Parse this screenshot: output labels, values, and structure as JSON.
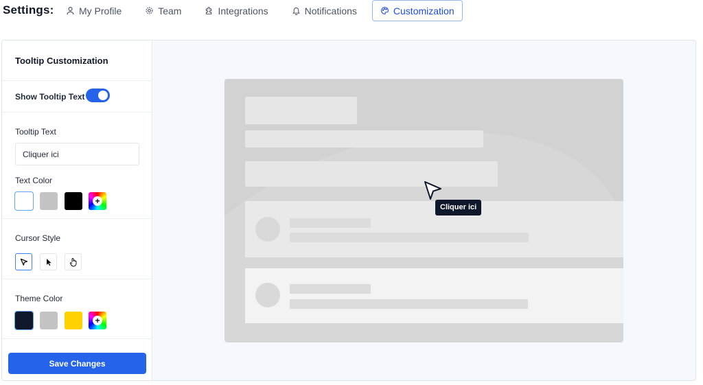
{
  "header": {
    "title": "Settings:",
    "tabs": [
      {
        "label": "My Profile",
        "icon": "user-icon"
      },
      {
        "label": "Team",
        "icon": "gear-icon"
      },
      {
        "label": "Integrations",
        "icon": "puzzle-icon"
      },
      {
        "label": "Notifications",
        "icon": "bell-icon"
      },
      {
        "label": "Customization",
        "icon": "palette-icon",
        "active": true
      }
    ]
  },
  "sidebar": {
    "title": "Tooltip Customization",
    "show_tooltip_label": "Show Tooltip Text",
    "show_tooltip_on": true,
    "tooltip_text_label": "Tooltip Text",
    "tooltip_text_value": "Cliquer ici",
    "text_color_label": "Text Color",
    "text_colors": [
      "#ffffff",
      "#c4c4c4",
      "#000000"
    ],
    "cursor_style_label": "Cursor Style",
    "cursor_styles": [
      "outline-pointer-icon",
      "filled-pointer-icon",
      "hand-icon"
    ],
    "theme_color_label": "Theme Color",
    "theme_colors": [
      "#0f172a",
      "#c4c4c4",
      "#ffd200"
    ],
    "save_label": "Save Changes"
  },
  "preview": {
    "tooltip_text": "Cliquer ici"
  },
  "colors": {
    "accent": "#2563eb"
  }
}
